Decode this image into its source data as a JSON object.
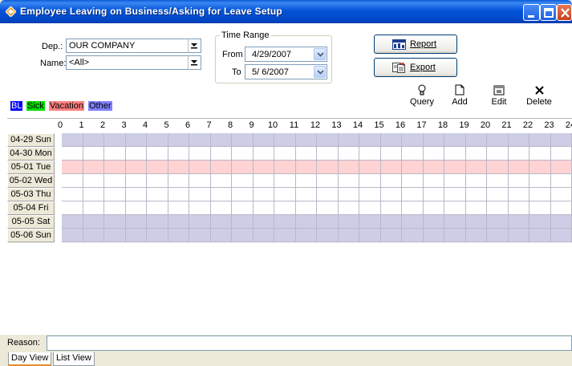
{
  "window": {
    "title": "Employee Leaving on Business/Asking for Leave Setup"
  },
  "filters": {
    "department_label": "Dep.:",
    "department_value": "OUR COMPANY",
    "name_label": "Name:",
    "name_value": "<All>"
  },
  "time_range": {
    "legend": "Time Range",
    "from_label": "From",
    "from_value": "4/29/2007",
    "to_label": "To",
    "to_value": "5/ 6/2007"
  },
  "buttons": {
    "report": "Report",
    "export": "Export"
  },
  "leave_types": [
    {
      "label": "BL",
      "color": "#0000ff",
      "text_color": "#ffffff"
    },
    {
      "label": "Sick",
      "color": "#00e000",
      "text_color": "#000000"
    },
    {
      "label": "Vacation",
      "color": "#ff8080",
      "text_color": "#000000"
    },
    {
      "label": "Other",
      "color": "#8080ff",
      "text_color": "#000000"
    }
  ],
  "toolbar": {
    "query": "Query",
    "add": "Add",
    "edit": "Edit",
    "delete": "Delete"
  },
  "hours": [
    "0",
    "1",
    "2",
    "3",
    "4",
    "5",
    "6",
    "7",
    "8",
    "9",
    "10",
    "11",
    "12",
    "13",
    "14",
    "15",
    "16",
    "17",
    "18",
    "19",
    "20",
    "21",
    "22",
    "23",
    "24"
  ],
  "days": [
    {
      "label": "04-29 Sun",
      "shade": "weekend"
    },
    {
      "label": "04-30 Mon",
      "shade": "none"
    },
    {
      "label": "05-01 Tue",
      "shade": "holiday"
    },
    {
      "label": "05-02 Wed",
      "shade": "none"
    },
    {
      "label": "05-03 Thu",
      "shade": "none"
    },
    {
      "label": "05-04 Fri",
      "shade": "none"
    },
    {
      "label": "05-05 Sat",
      "shade": "weekend"
    },
    {
      "label": "05-06 Sun",
      "shade": "weekend"
    }
  ],
  "row_colors": {
    "weekend": "#cdcde6",
    "holiday": "#ffd3d3",
    "none": "#ffffff"
  },
  "reason": {
    "label": "Reason:",
    "value": ""
  },
  "tabs": [
    {
      "label": "Day View",
      "active": true
    },
    {
      "label": "List View",
      "active": false
    }
  ]
}
